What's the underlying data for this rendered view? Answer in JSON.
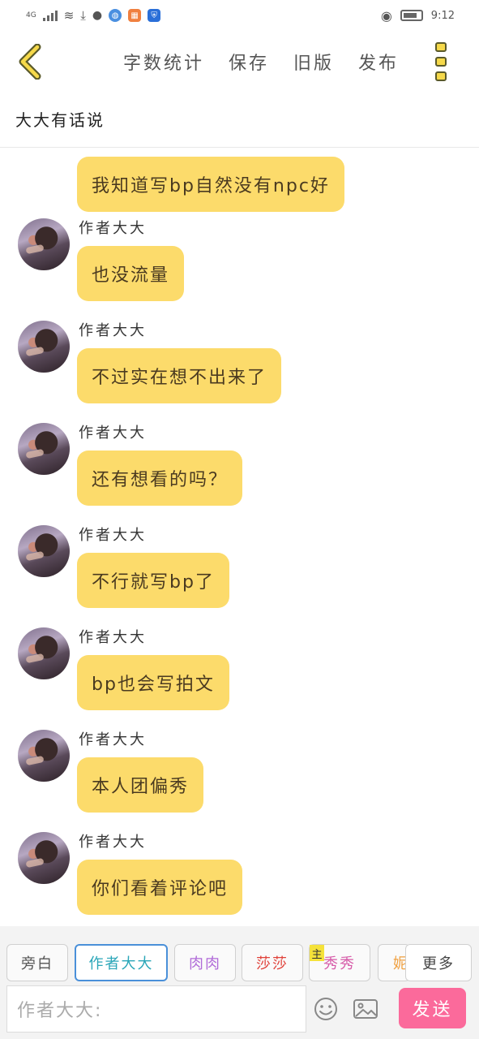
{
  "status_bar": {
    "signal": "4G",
    "time": "9:12"
  },
  "header": {
    "menu": [
      "字数统计",
      "保存",
      "旧版",
      "发布"
    ]
  },
  "title": "大大有话说",
  "messages": [
    {
      "sender": "",
      "text": "我知道写bp自然没有npc好"
    },
    {
      "sender": "作者大大",
      "text": "也没流量"
    },
    {
      "sender": "作者大大",
      "text": "不过实在想不出来了"
    },
    {
      "sender": "作者大大",
      "text": "还有想看的吗？"
    },
    {
      "sender": "作者大大",
      "text": "不行就写bp了"
    },
    {
      "sender": "作者大大",
      "text": "bp也会写拍文"
    },
    {
      "sender": "作者大大",
      "text": "本人团偏秀"
    },
    {
      "sender": "作者大大",
      "text": "你们看着评论吧"
    }
  ],
  "roles": [
    {
      "label": "旁白",
      "color": "#555555"
    },
    {
      "label": "作者大大",
      "color": "#2aa6b8",
      "active": true
    },
    {
      "label": "肉肉",
      "color": "#b06ad8"
    },
    {
      "label": "莎莎",
      "color": "#e0423a"
    },
    {
      "label": "秀秀",
      "color": "#d65aa8",
      "tag": "主"
    },
    {
      "label": "妮",
      "color": "#f0a040"
    }
  ],
  "more_label": "更多",
  "input": {
    "placeholder": "作者大大:"
  },
  "send_label": "发送"
}
